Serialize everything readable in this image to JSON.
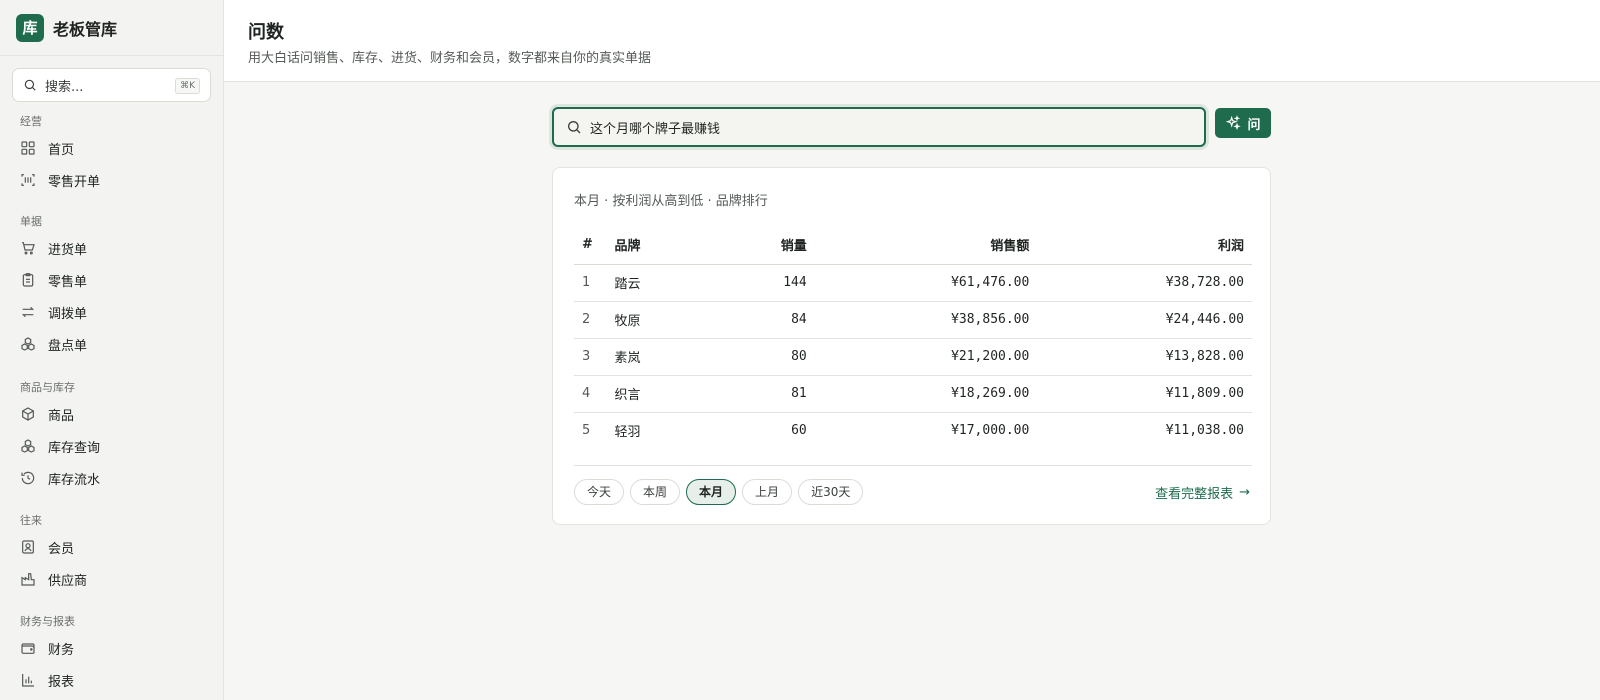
{
  "app": {
    "logo_char": "库",
    "name": "老板管库"
  },
  "search": {
    "placeholder": "搜索...",
    "shortcut": "⌘K"
  },
  "sidebar": {
    "groups": [
      {
        "title": "经营",
        "items": [
          {
            "label": "首页",
            "icon": "grid-icon"
          },
          {
            "label": "零售开单",
            "icon": "scan-icon"
          }
        ]
      },
      {
        "title": "单据",
        "items": [
          {
            "label": "进货单",
            "icon": "cart-icon"
          },
          {
            "label": "零售单",
            "icon": "clipboard-icon"
          },
          {
            "label": "调拨单",
            "icon": "transfer-icon"
          },
          {
            "label": "盘点单",
            "icon": "boxes-icon"
          }
        ]
      },
      {
        "title": "商品与库存",
        "items": [
          {
            "label": "商品",
            "icon": "package-icon"
          },
          {
            "label": "库存查询",
            "icon": "boxes-icon"
          },
          {
            "label": "库存流水",
            "icon": "history-icon"
          }
        ]
      },
      {
        "title": "往来",
        "items": [
          {
            "label": "会员",
            "icon": "member-card-icon"
          },
          {
            "label": "供应商",
            "icon": "factory-icon"
          }
        ]
      },
      {
        "title": "财务与报表",
        "items": [
          {
            "label": "财务",
            "icon": "wallet-icon"
          },
          {
            "label": "报表",
            "icon": "bar-chart-icon"
          }
        ]
      }
    ]
  },
  "header": {
    "title": "问数",
    "subtitle": "用大白话问销售、库存、进货、财务和会员，数字都来自你的真实单据"
  },
  "ask": {
    "query": "这个月哪个牌子最赚钱",
    "button_label": "问"
  },
  "result": {
    "caption": "本月 · 按利润从高到低 · 品牌排行",
    "columns": [
      "#",
      "品牌",
      "销量",
      "销售额",
      "利润"
    ],
    "rows": [
      [
        "1",
        "踏云",
        "144",
        "¥61,476.00",
        "¥38,728.00"
      ],
      [
        "2",
        "牧原",
        "84",
        "¥38,856.00",
        "¥24,446.00"
      ],
      [
        "3",
        "素岚",
        "80",
        "¥21,200.00",
        "¥13,828.00"
      ],
      [
        "4",
        "织言",
        "81",
        "¥18,269.00",
        "¥11,809.00"
      ],
      [
        "5",
        "轻羽",
        "60",
        "¥17,000.00",
        "¥11,038.00"
      ]
    ],
    "periods": [
      "今天",
      "本周",
      "本月",
      "上月",
      "近30天"
    ],
    "active_period": "本月",
    "report_link": "查看完整报表",
    "report_arrow": "→"
  },
  "colors": {
    "accent": "#1e6b4d",
    "sidebar_bg": "#f3f3f1",
    "page_bg": "#f6f6f4"
  }
}
